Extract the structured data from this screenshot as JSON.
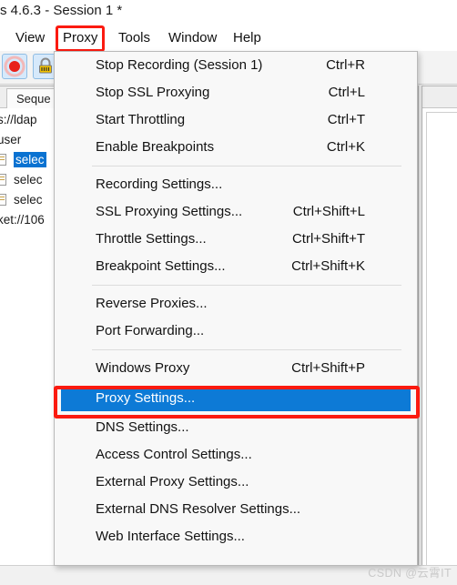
{
  "window": {
    "title": "s 4.6.3 - Session 1 *"
  },
  "menubar": {
    "items": [
      {
        "label": "View",
        "highlighted": false
      },
      {
        "label": "Proxy",
        "highlighted": true
      },
      {
        "label": "Tools",
        "highlighted": false
      },
      {
        "label": "Window",
        "highlighted": false
      },
      {
        "label": "Help",
        "highlighted": false
      }
    ]
  },
  "toolbar": {
    "buttons": [
      {
        "name": "record-button",
        "icon": "record-icon"
      },
      {
        "name": "ssl-proxy-button",
        "icon": "lock-icon"
      }
    ]
  },
  "left_pane": {
    "tab_label": "Seque",
    "tree_rows": [
      {
        "label": "s://ldap",
        "icon": false,
        "selected": false
      },
      {
        "label": "user",
        "icon": false,
        "selected": false
      },
      {
        "label": "selec",
        "icon": true,
        "selected": true
      },
      {
        "label": "selec",
        "icon": true,
        "selected": false
      },
      {
        "label": "selec",
        "icon": true,
        "selected": false
      },
      {
        "label": "ket://106",
        "icon": false,
        "selected": false
      }
    ]
  },
  "dropdown": {
    "name": "proxy-menu",
    "groups": [
      {
        "items": [
          {
            "label": "Stop Recording (Session 1)",
            "accel": "Ctrl+R",
            "selected": false
          },
          {
            "label": "Stop SSL Proxying",
            "accel": "Ctrl+L",
            "selected": false
          },
          {
            "label": "Start Throttling",
            "accel": "Ctrl+T",
            "selected": false
          },
          {
            "label": "Enable Breakpoints",
            "accel": "Ctrl+K",
            "selected": false
          }
        ]
      },
      {
        "items": [
          {
            "label": "Recording Settings...",
            "accel": "",
            "selected": false
          },
          {
            "label": "SSL Proxying Settings...",
            "accel": "Ctrl+Shift+L",
            "selected": false
          },
          {
            "label": "Throttle Settings...",
            "accel": "Ctrl+Shift+T",
            "selected": false
          },
          {
            "label": "Breakpoint Settings...",
            "accel": "Ctrl+Shift+K",
            "selected": false
          }
        ]
      },
      {
        "items": [
          {
            "label": "Reverse Proxies...",
            "accel": "",
            "selected": false
          },
          {
            "label": "Port Forwarding...",
            "accel": "",
            "selected": false
          }
        ]
      },
      {
        "items": [
          {
            "label": "Windows Proxy",
            "accel": "Ctrl+Shift+P",
            "selected": false
          },
          {
            "label": "Proxy Settings...",
            "accel": "",
            "selected": true
          },
          {
            "label": "DNS Settings...",
            "accel": "",
            "selected": false
          },
          {
            "label": "Access Control Settings...",
            "accel": "",
            "selected": false
          },
          {
            "label": "External Proxy Settings...",
            "accel": "",
            "selected": false
          },
          {
            "label": "External DNS Resolver Settings...",
            "accel": "",
            "selected": false
          },
          {
            "label": "Web Interface Settings...",
            "accel": "",
            "selected": false
          }
        ]
      }
    ]
  },
  "watermark": {
    "text": "CSDN @云霄IT"
  },
  "colors": {
    "accent_blue": "#0d7ad6",
    "highlight_red": "#fb1a10",
    "menu_bg": "#f8f8f8",
    "text": "#121212"
  }
}
